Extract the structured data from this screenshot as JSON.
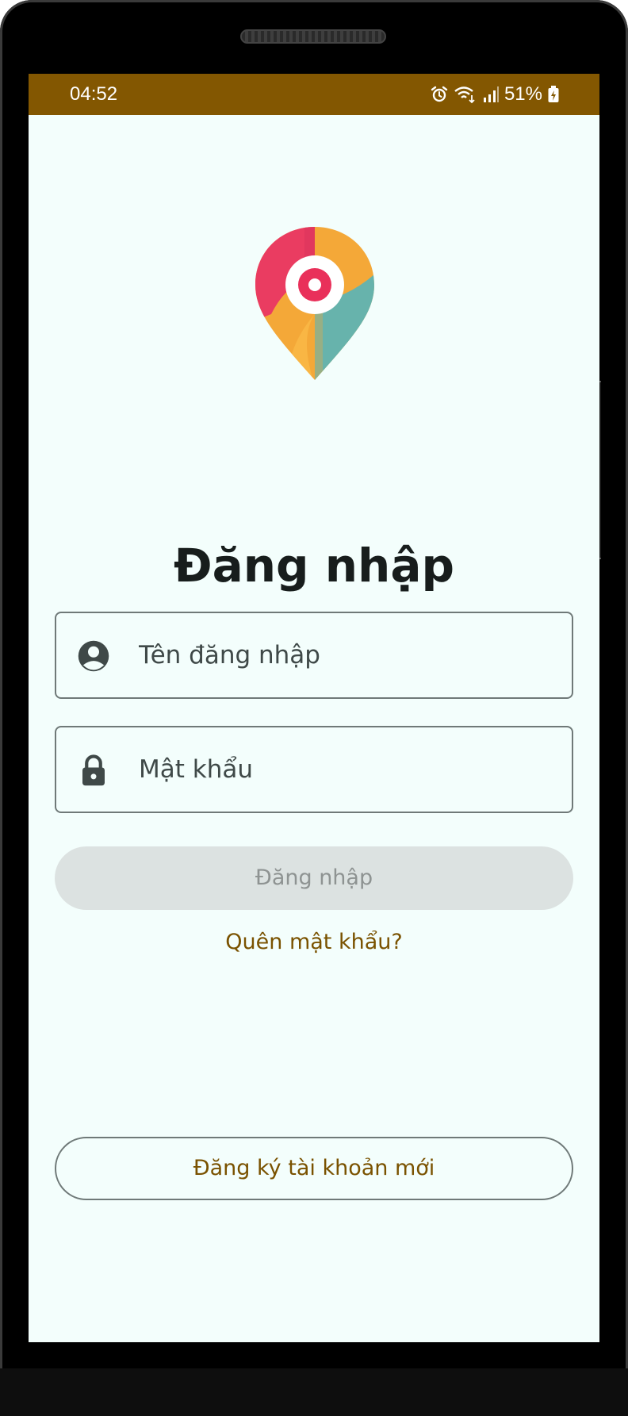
{
  "status_bar": {
    "time": "04:52",
    "battery": "51%",
    "icons": [
      "alarm-icon",
      "wifi-icon",
      "signal-icon",
      "battery-charging-icon"
    ],
    "background_color": "#835701"
  },
  "app": {
    "logo": "map-pin-logo",
    "title": "Đăng nhập"
  },
  "form": {
    "username": {
      "placeholder": "Tên đăng nhập",
      "value": "",
      "icon": "account-circle-icon"
    },
    "password": {
      "placeholder": "Mật khẩu",
      "value": "",
      "icon": "lock-icon"
    },
    "login_button": "Đăng nhập",
    "forgot_password": "Quên mật khẩu?"
  },
  "register_button": "Đăng ký tài khoản mới",
  "colors": {
    "background": "#f3fefc",
    "accent": "#7a5200",
    "disabled_button": "#dce2e1",
    "outline": "#6f7978"
  }
}
